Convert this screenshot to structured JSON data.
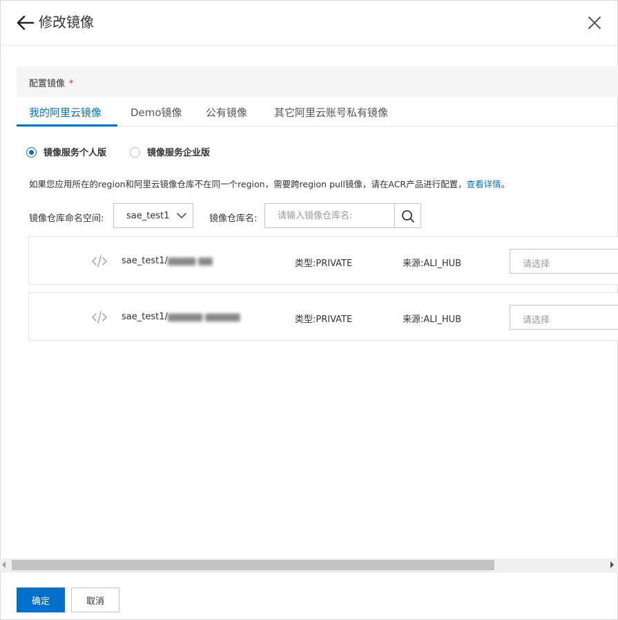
{
  "header": {
    "title": "修改镜像",
    "back_icon": "arrow-left-icon",
    "close_icon": "close-icon"
  },
  "section": {
    "label": "配置镜像",
    "required_mark": "*"
  },
  "tabs": [
    {
      "label": "我的阿里云镜像",
      "active": true
    },
    {
      "label": "Demo镜像",
      "active": false
    },
    {
      "label": "公有镜像",
      "active": false
    },
    {
      "label": "其它阿里云账号私有镜像",
      "active": false
    }
  ],
  "edition": {
    "options": [
      {
        "label": "镜像服务个人版",
        "checked": true
      },
      {
        "label": "镜像服务企业版",
        "checked": false
      }
    ]
  },
  "notice": {
    "text": "如果您应用所在的region和阿里云镜像仓库不在同一个region，需要跨region pull镜像，请在ACR产品进行配置，",
    "link": "查看详情",
    "end": "。"
  },
  "filters": {
    "namespace_label": "镜像仓库命名空间:",
    "namespace_value": "sae_test1",
    "repo_label": "镜像仓库名:",
    "repo_placeholder": "请输入镜像仓库名:"
  },
  "repos": [
    {
      "icon": "code-icon",
      "namespace_prefix": "sae_test1/",
      "name_blurred": "▆▆▆▆-▆▆",
      "type": "类型:PRIVATE",
      "source": "来源:ALI_HUB",
      "version_placeholder": "请选择"
    },
    {
      "icon": "code-icon",
      "namespace_prefix": "sae_test1/",
      "name_blurred": "▆▆▆▆▆-▆▆▆▆▆",
      "type": "类型:PRIVATE",
      "source": "来源:ALI_HUB",
      "version_placeholder": "请选择"
    }
  ],
  "footer": {
    "confirm": "确定",
    "cancel": "取消"
  },
  "colors": {
    "primary": "#0070cc",
    "required": "#d93026"
  }
}
